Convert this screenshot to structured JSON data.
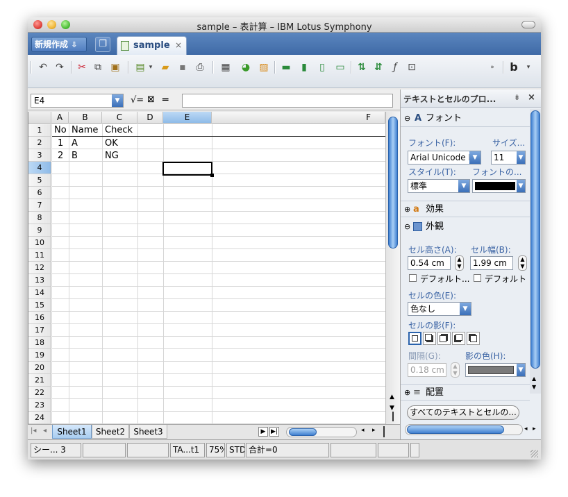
{
  "window": {
    "title": "sample – 表計算 – IBM Lotus Symphony",
    "traffic_lights": {
      "close": "#e0443e",
      "minimize": "#f0b73a",
      "zoom": "#4fbf3a"
    }
  },
  "tabs": {
    "new_button_label": "新規作成",
    "doc_tab_label": "sample",
    "doc_tab_close": "×"
  },
  "formula_bar": {
    "name_box_value": "E4",
    "input_value": ""
  },
  "grid": {
    "columns": [
      "A",
      "B",
      "C",
      "D",
      "E",
      "F"
    ],
    "selected_column": "E",
    "rows": [
      "1",
      "2",
      "3",
      "4",
      "5",
      "6",
      "7",
      "8",
      "9",
      "10",
      "11",
      "12",
      "13",
      "14",
      "15",
      "16",
      "17",
      "18",
      "19",
      "20",
      "21",
      "22",
      "23",
      "24"
    ],
    "selected_row": "4",
    "cells": {
      "A1": "No",
      "B1": "Name",
      "C1": "Check",
      "A2": "1",
      "B2": "A",
      "C2": "OK",
      "A3": "2",
      "B3": "B",
      "C3": "NG"
    }
  },
  "sheets": [
    "Sheet1",
    "Sheet2",
    "Sheet3"
  ],
  "active_sheet": "Sheet1",
  "panel": {
    "title": "テキストとセルのプロ...",
    "font_section": "フォント",
    "font_label": "フォント(F):",
    "size_label": "サイズ...",
    "font_value": "Arial Unicode MS",
    "size_value": "11",
    "style_label": "スタイル(T):",
    "font_color_label": "フォントの...",
    "style_value": "標準",
    "font_color": "#000000",
    "effects_section": "効果",
    "appearance_section": "外観",
    "cell_height_label": "セル高さ(A):",
    "cell_width_label": "セル幅(B):",
    "cell_height_value": "0.54 cm",
    "cell_width_value": "1.99 cm",
    "default_check_1": "デフォルト...",
    "default_check_2": "デフォルト",
    "cell_color_label": "セルの色(E):",
    "cell_color_value": "色なし",
    "cell_shadow_label": "セルの影(F):",
    "spacing_label": "間隔(G):",
    "shadow_color_label": "影の色(H):",
    "spacing_value": "0.18 cm",
    "shadow_color": "#7a7a7a",
    "align_section": "配置",
    "all_props_button": "すべてのテキストとセルの..."
  },
  "status_bar": {
    "cells": [
      "シー... 3",
      "",
      "",
      "TA...t1",
      "75%",
      "STD",
      "合計=0",
      "",
      "",
      ""
    ]
  }
}
